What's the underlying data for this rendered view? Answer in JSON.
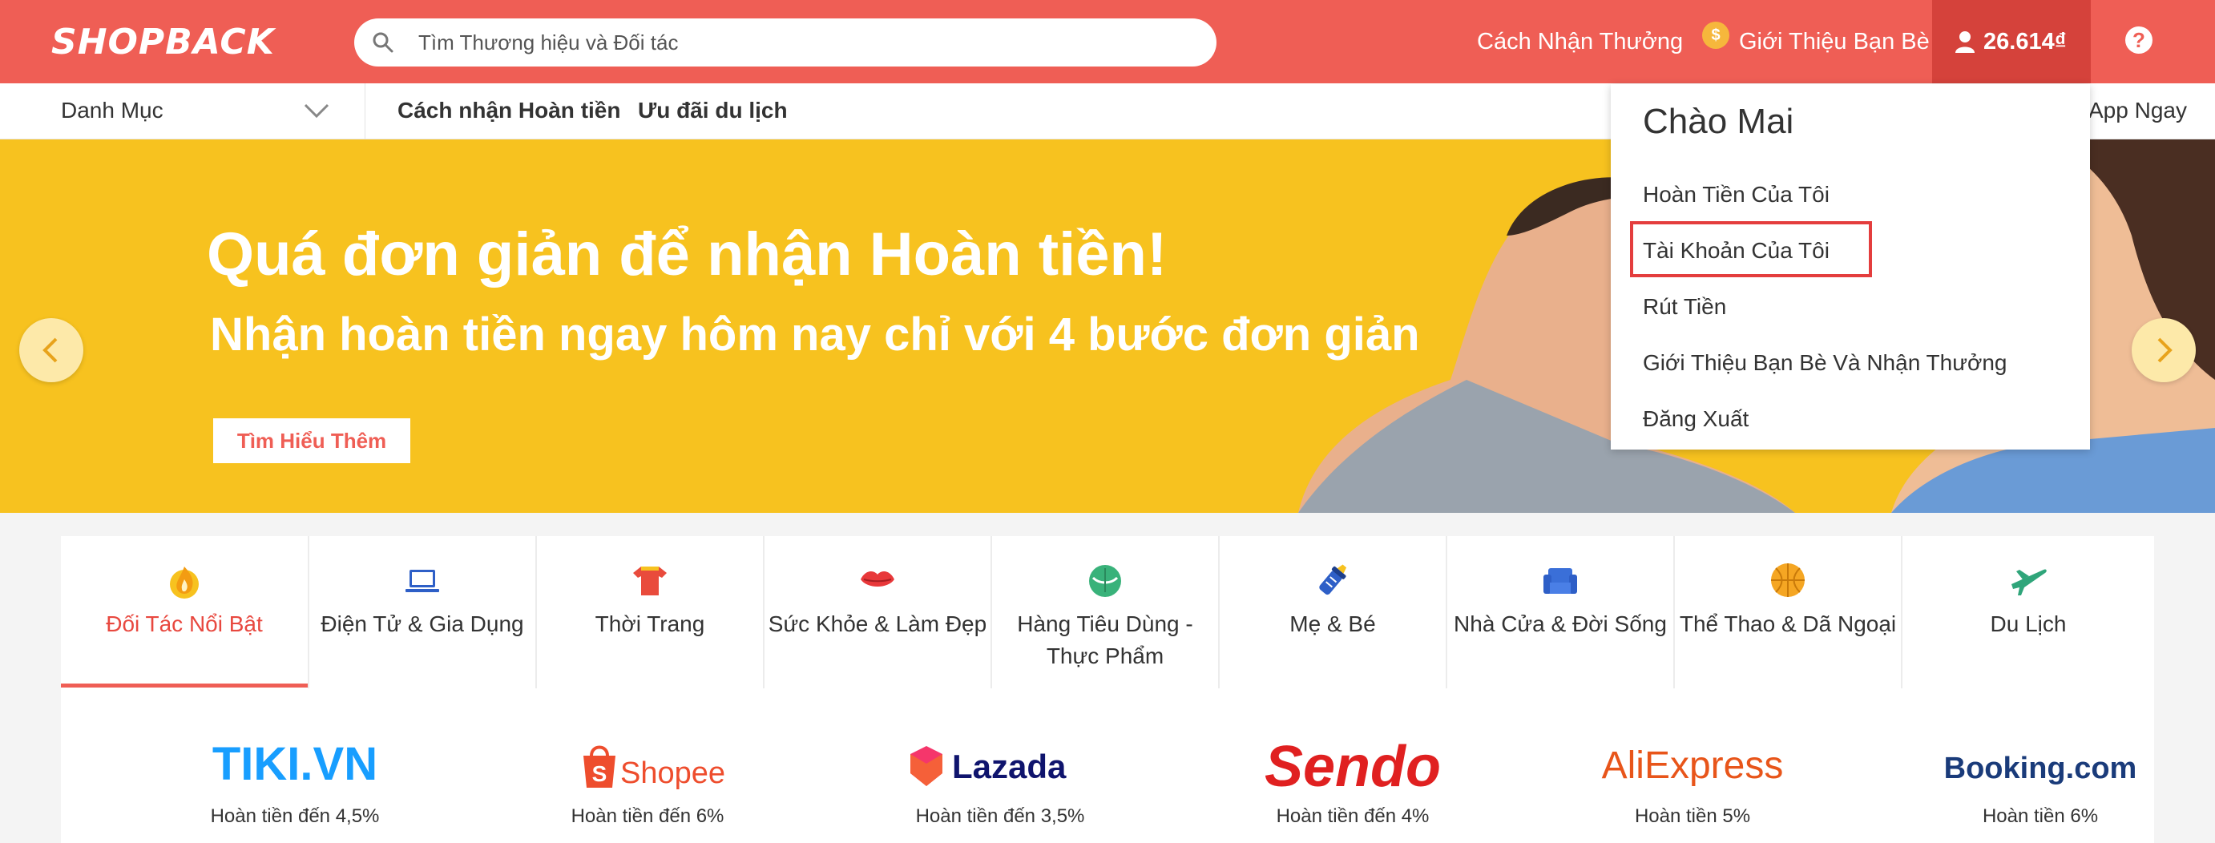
{
  "header": {
    "logo": "SHOPBACK",
    "search_placeholder": "Tìm Thương hiệu và Đối tác",
    "how_to_earn": "Cách Nhận Thưởng",
    "refer_friends": "Giới Thiệu Bạn Bè",
    "coin_symbol": "$",
    "balance": "26.614₫",
    "help_symbol": "?"
  },
  "subnav": {
    "category": "Danh Mục",
    "links": [
      "Cách nhận Hoàn tiền",
      "Ưu đãi du lịch"
    ],
    "app_link": "App Ngay"
  },
  "hero": {
    "title": "Quá đơn giản để nhận Hoàn tiền!",
    "subtitle": "Nhận hoàn tiền ngay hôm nay chỉ với 4 bước đơn giản",
    "button": "Tìm Hiểu Thêm"
  },
  "dropdown": {
    "greeting": "Chào Mai",
    "items": [
      "Hoàn Tiền Của Tôi",
      "Tài Khoản Của Tôi",
      "Rút Tiền",
      "Giới Thiệu Bạn Bè Và Nhận Thưởng",
      "Đăng Xuất"
    ],
    "highlighted_item": "Tài Khoản Của Tôi"
  },
  "tabs": [
    {
      "label": "Đối Tác Nổi Bật",
      "icon": "fire-icon",
      "active": true
    },
    {
      "label": "Điện Tử & Gia Dụng",
      "icon": "laptop-icon"
    },
    {
      "label": "Thời Trang",
      "icon": "shirt-icon"
    },
    {
      "label": "Sức Khỏe & Làm Đẹp",
      "icon": "lips-icon"
    },
    {
      "label": "Hàng Tiêu Dùng - Thực Phẩm",
      "icon": "cabbage-icon"
    },
    {
      "label": "Mẹ & Bé",
      "icon": "baby-bottle-icon"
    },
    {
      "label": "Nhà Cửa & Đời Sống",
      "icon": "sofa-icon"
    },
    {
      "label": "Thể Thao & Dã Ngoại",
      "icon": "basketball-icon"
    },
    {
      "label": "Du Lịch",
      "icon": "airplane-icon"
    }
  ],
  "partners": [
    {
      "name": "TIKI.VN",
      "cashback": "Hoàn tiền đến 4,5%"
    },
    {
      "name": "Shopee",
      "cashback": "Hoàn tiền đến 6%"
    },
    {
      "name": "Lazada",
      "cashback": "Hoàn tiền đến 3,5%"
    },
    {
      "name": "Sendo",
      "cashback": "Hoàn tiền đến 4%"
    },
    {
      "name": "AliExpress",
      "cashback": "Hoàn tiền 5%"
    },
    {
      "name": "Booking.com",
      "cashback": "Hoàn tiền 6%"
    }
  ],
  "colors": {
    "brand": "#ef5e55",
    "brand_dark": "#d5423b",
    "hero_bg": "#f7c21f",
    "highlight_box": "#e43d3d"
  }
}
